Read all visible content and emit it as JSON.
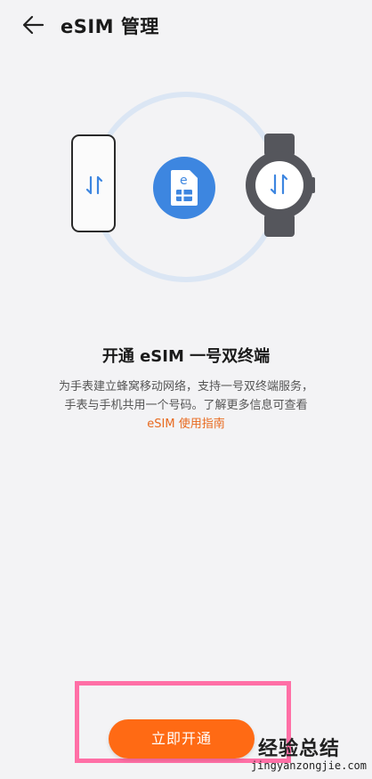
{
  "header": {
    "title": "eSIM 管理",
    "back_icon": "arrow-left-icon"
  },
  "illustration": {
    "phone_icon": "phone-icon",
    "sim_icon": "esim-card-icon",
    "sim_letter": "e",
    "watch_icon": "smartwatch-icon",
    "transfer_icon": "transfer-arrows-icon",
    "accent_color": "#3d86e0"
  },
  "content": {
    "headline": "开通 eSIM 一号双终端",
    "description_line1": "为手表建立蜂窝移动网络，支持一号双终端服务，",
    "description_line2": "手表与手机共用一个号码。了解更多信息可查看",
    "link_text": "eSIM 使用指南",
    "link_color": "#e86a1f"
  },
  "footer": {
    "activate_label": "立即开通",
    "button_color": "#ff6a14",
    "highlight_color": "#ff6fa6"
  },
  "watermark": {
    "main": "经验总结",
    "sub": "jingyanzongjie.com"
  }
}
